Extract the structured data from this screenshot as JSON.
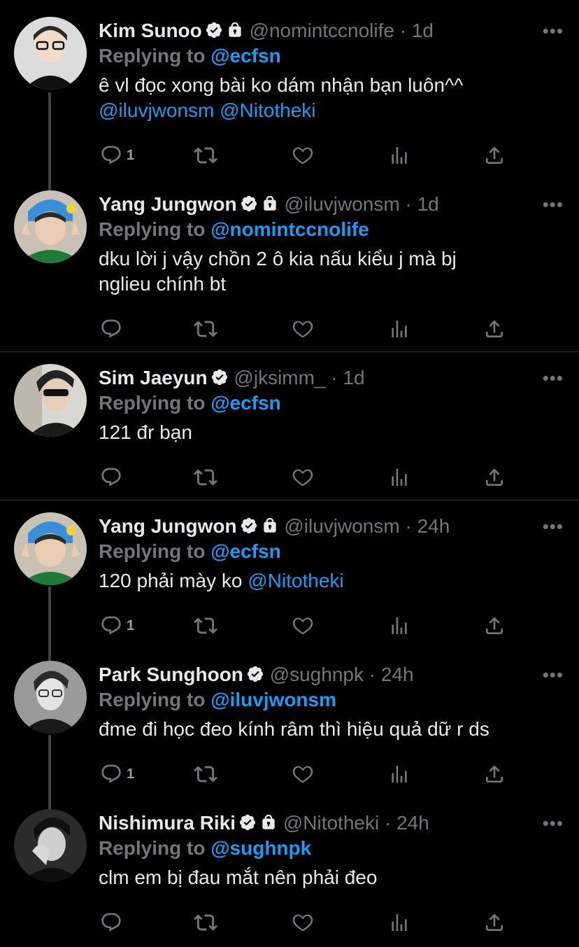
{
  "verified_icon": "verified-badge-icon",
  "lock_icon": "lock-icon",
  "colors": {
    "accent": "#1d9bf0",
    "muted": "#71767b",
    "background": "#000000",
    "text": "#e7e9ea"
  },
  "tweets": [
    {
      "name": "Kim Sunoo",
      "handle": "@nomintccnolife",
      "time": "1d",
      "protected": true,
      "replying_prefix": "Replying to",
      "replying_to": "@ecfsn",
      "text_plain": "ê vl đọc xong bài ko dám nhận bạn luôn^^",
      "mentions": "@iluvjwonsm @Nitotheki",
      "reply_count": "1"
    },
    {
      "name": "Yang Jungwon",
      "handle": "@iluvjwonsm",
      "time": "1d",
      "protected": true,
      "replying_prefix": "Replying to",
      "replying_to": "@nomintccnolife",
      "text_line1": "dku lời j vậy chồn 2 ô kia nấu kiểu j mà bj",
      "text_line2": "nglieu chính bt",
      "reply_count": ""
    },
    {
      "name": "Sim Jaeyun",
      "handle": "@jksimm_",
      "time": "1d",
      "protected": false,
      "replying_prefix": "Replying to",
      "replying_to": "@ecfsn",
      "text": "121 đr bạn",
      "reply_count": ""
    },
    {
      "name": "Yang Jungwon",
      "handle": "@iluvjwonsm",
      "time": "24h",
      "protected": true,
      "replying_prefix": "Replying to",
      "replying_to": "@ecfsn",
      "text_plain": "120 phải mày ko",
      "mentions": "@Nitotheki",
      "reply_count": "1"
    },
    {
      "name": "Park Sunghoon",
      "handle": "@sughnpk",
      "time": "24h",
      "protected": false,
      "replying_prefix": "Replying to",
      "replying_to": "@iluvjwonsm",
      "text": "đme đi học đeo kính râm thì hiệu quả dữ r ds",
      "reply_count": "1"
    },
    {
      "name": "Nishimura Riki",
      "handle": "@Nitotheki",
      "time": "24h",
      "protected": true,
      "replying_prefix": "Replying to",
      "replying_to": "@sughnpk",
      "text": "clm em bị đau mắt nên phải đeo",
      "reply_count": ""
    }
  ],
  "separator": "·",
  "more_label": "•••"
}
